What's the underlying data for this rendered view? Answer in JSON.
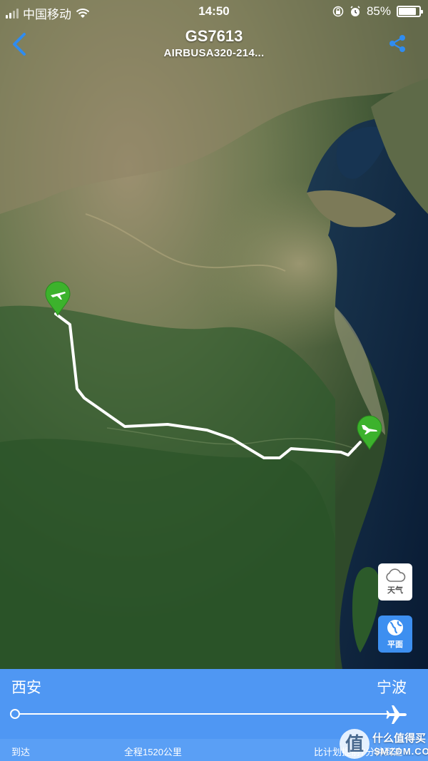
{
  "status_bar": {
    "carrier": "中国移动",
    "time": "14:50",
    "battery": "85%",
    "battery_level": 0.85
  },
  "header": {
    "flight_number": "GS7613",
    "aircraft": "AIRBUSA320-214..."
  },
  "map_controls": {
    "weather_label": "天气",
    "flat_label": "平面"
  },
  "route": {
    "departure_city": "西安",
    "arrival_city": "宁波",
    "progress": 0.0
  },
  "info_row": {
    "status": "到达",
    "distance": "全程1520公里",
    "schedule": "比计划提前7分钟到达"
  },
  "watermark": {
    "logo_char": "值",
    "text": "什么值得买",
    "url": "SMZDM.COM"
  },
  "colors": {
    "accent_blue": "#4f97f3",
    "pin_green": "#3cb22c",
    "ios_blue": "#2f8cf0"
  }
}
